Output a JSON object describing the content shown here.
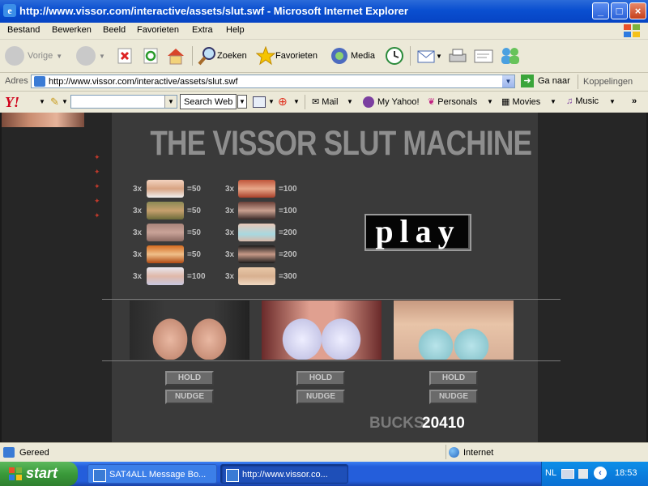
{
  "window": {
    "title": "http://www.vissor.com/interactive/assets/slut.swf - Microsoft Internet Explorer",
    "controls": [
      "_",
      "□",
      "×"
    ]
  },
  "menu": [
    "Bestand",
    "Bewerken",
    "Beeld",
    "Favorieten",
    "Extra",
    "Help"
  ],
  "toolbar": {
    "back": "Vorige",
    "search": "Zoeken",
    "favorites": "Favorieten",
    "media": "Media"
  },
  "address": {
    "label": "Adres",
    "url": "http://www.vissor.com/interactive/assets/slut.swf",
    "go": "Ga naar",
    "links": "Koppelingen"
  },
  "yahoo": {
    "logo": "Y!",
    "search_button": "Search Web",
    "items": [
      "Mail",
      "My Yahoo!",
      "Personals",
      "Movies",
      "Music"
    ],
    "more": "»"
  },
  "game": {
    "title": "THE VISSOR SLUT MACHINE",
    "paytable_left": [
      {
        "mult": "3x",
        "value": "=50"
      },
      {
        "mult": "3x",
        "value": "=50"
      },
      {
        "mult": "3x",
        "value": "=50"
      },
      {
        "mult": "3x",
        "value": "=50"
      },
      {
        "mult": "3x",
        "value": "=100"
      }
    ],
    "paytable_right": [
      {
        "mult": "3x",
        "value": "=100"
      },
      {
        "mult": "3x",
        "value": "=100"
      },
      {
        "mult": "3x",
        "value": "=200"
      },
      {
        "mult": "3x",
        "value": "=200"
      },
      {
        "mult": "3x",
        "value": "=300"
      }
    ],
    "play": "play",
    "hold": "HOLD",
    "nudge": "NUDGE",
    "bucks_label": "BUCKS:",
    "bucks_value": "20410"
  },
  "status": {
    "text": "Gereed",
    "zone": "Internet"
  },
  "taskbar": {
    "start": "start",
    "tasks": [
      "SAT4ALL Message Bo...",
      "http://www.vissor.co..."
    ],
    "lang": "NL",
    "time": "18:53"
  }
}
